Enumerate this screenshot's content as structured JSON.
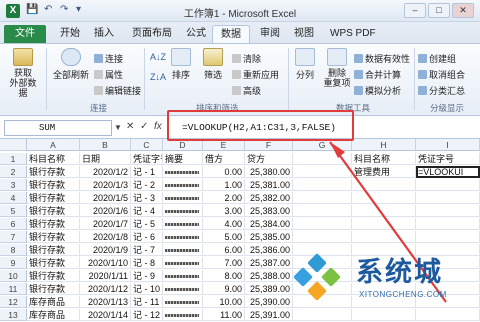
{
  "window": {
    "title": "工作簿1 - Microsoft Excel",
    "app_icon": "X"
  },
  "quick_access": {
    "save": "💾",
    "undo": "↶",
    "redo": "↷",
    "customize": "▾"
  },
  "window_controls": {
    "minimize": "–",
    "maximize": "□",
    "close": "✕"
  },
  "ribbon_tabs": [
    "文件",
    "开始",
    "插入",
    "页面布局",
    "公式",
    "数据",
    "审阅",
    "视图",
    "WPS PDF"
  ],
  "ribbon": {
    "get_external_data": "获取\n外部数据",
    "refresh_all": "全部刷新",
    "connections": "连接",
    "properties": "属性",
    "edit_links": "编辑链接",
    "group_connections": "连接",
    "sort_az": "A↓Z",
    "sort_za": "Z↓A",
    "sort": "排序",
    "filter": "筛选",
    "clear": "清除",
    "reapply": "重新应用",
    "advanced": "高级",
    "group_sort_filter": "排序和筛选",
    "text_to_columns": "分列",
    "remove_duplicates": "删除\n重复项",
    "data_validation": "数据有效性",
    "consolidate": "合并计算",
    "what_if": "模拟分析",
    "group_data_tools": "数据工具",
    "group": "创建组",
    "ungroup": "取消组合",
    "subtotal": "分类汇总",
    "group_outline": "分级显示"
  },
  "formula_bar": {
    "name_box": "SUM",
    "cancel": "✕",
    "enter": "✓",
    "fx": "fx",
    "formula": "=VLOOKUP(H2,A1:C31,3,FALSE)"
  },
  "sheet": {
    "columns": [
      "A",
      "B",
      "C",
      "D",
      "E",
      "F",
      "G",
      "H",
      "I"
    ],
    "rows": [
      [
        "科目名称",
        "日期",
        "凭证字号",
        "摘要",
        "借方",
        "贷方",
        "",
        "科目名称",
        "凭证字号"
      ],
      [
        "银行存款",
        "2020/1/2",
        "记 - 1",
        "blur",
        "0.00",
        "25,380.00",
        "",
        "管理费用",
        "=VLOOKUI"
      ],
      [
        "银行存款",
        "2020/1/3",
        "记 - 2",
        "blur",
        "1.00",
        "25,381.00",
        "",
        "",
        ""
      ],
      [
        "银行存款",
        "2020/1/5",
        "记 - 3",
        "blur",
        "2.00",
        "25,382.00",
        "",
        "",
        ""
      ],
      [
        "银行存款",
        "2020/1/6",
        "记 - 4",
        "blur",
        "3.00",
        "25,383.00",
        "",
        "",
        ""
      ],
      [
        "银行存款",
        "2020/1/7",
        "记 - 5",
        "blur",
        "4.00",
        "25,384.00",
        "",
        "",
        ""
      ],
      [
        "银行存款",
        "2020/1/8",
        "记 - 6",
        "blur",
        "5.00",
        "25,385.00",
        "",
        "",
        ""
      ],
      [
        "银行存款",
        "2020/1/9",
        "记 - 7",
        "blur",
        "6.00",
        "25,386.00",
        "",
        "",
        ""
      ],
      [
        "银行存款",
        "2020/1/10",
        "记 - 8",
        "blur",
        "7.00",
        "25,387.00",
        "",
        "",
        ""
      ],
      [
        "银行存款",
        "2020/1/11",
        "记 - 9",
        "blur",
        "8.00",
        "25,388.00",
        "",
        "",
        ""
      ],
      [
        "银行存款",
        "2020/1/12",
        "记 - 10",
        "blur",
        "9.00",
        "25,389.00",
        "",
        "",
        ""
      ],
      [
        "库存商品",
        "2020/1/13",
        "记 - 11",
        "blur",
        "10.00",
        "25,390.00",
        "",
        "",
        ""
      ],
      [
        "库存商品",
        "2020/1/14",
        "记 - 12",
        "blur",
        "11.00",
        "25,391.00",
        "",
        "",
        ""
      ]
    ]
  },
  "watermark": {
    "text": "系统城",
    "sub": "XITONGCHENG.COM"
  }
}
